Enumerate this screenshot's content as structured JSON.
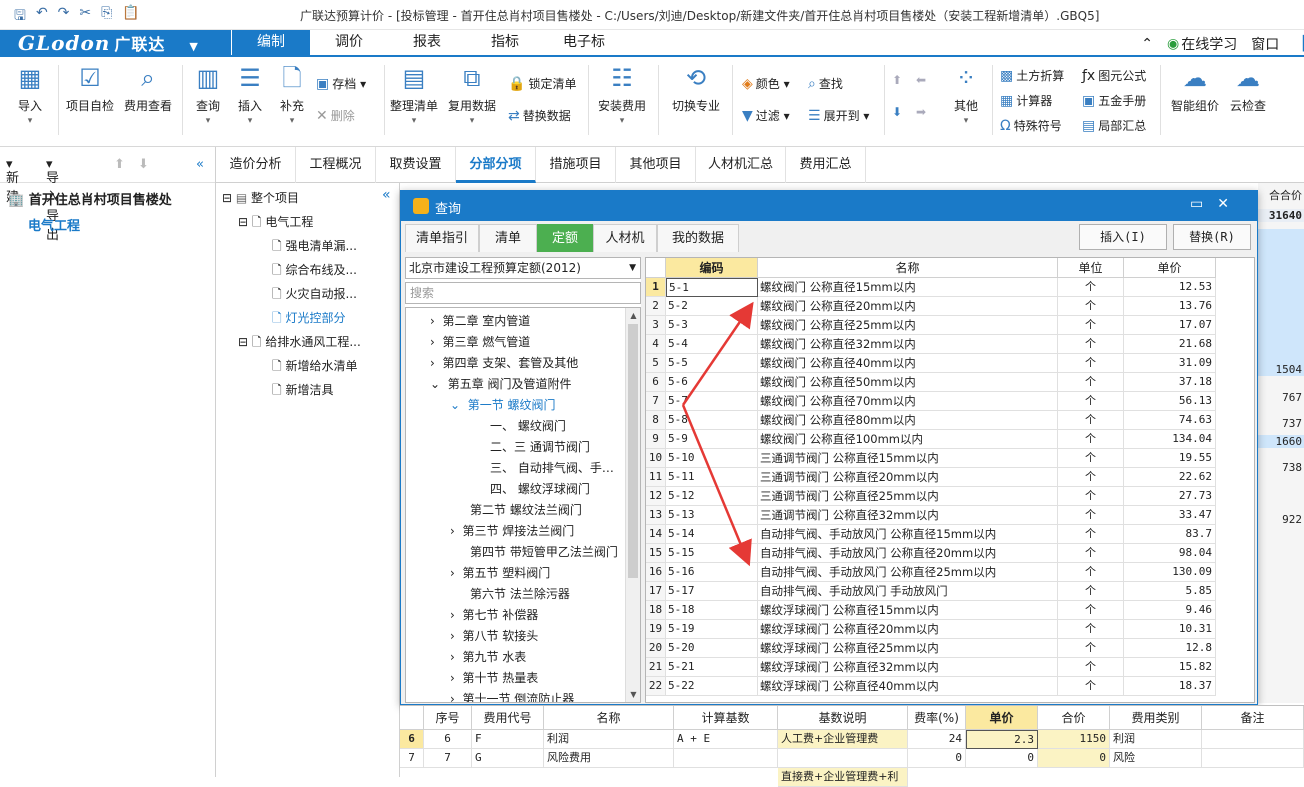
{
  "titlebar": {
    "title": "广联达预算计价 - [投标管理 - 首开住总肖村项目售楼处 - C:/Users/刘迪/Desktop/新建文件夹/首开住总肖村项目售楼处（安装工程新增清单）.GBQ5]"
  },
  "logo": {
    "text": "GLodon",
    "cn": "广联达"
  },
  "menu": {
    "tabs": [
      "编制",
      "调价",
      "报表",
      "指标",
      "电子标"
    ],
    "online": "在线学习",
    "window": "窗口"
  },
  "ribbon": {
    "import": "导入",
    "selfcheck": "项目自检",
    "feecheck": "费用查看",
    "query": "查询",
    "insert": "插入",
    "supplement": "补充",
    "storeprice": "存档",
    "delete": "删除",
    "organize": "整理清单",
    "reuse": "复用数据",
    "lock": "锁定清单",
    "replace": "替换数据",
    "install": "安装费用",
    "switch": "切换专业",
    "color": "颜色",
    "find": "查找",
    "filter": "过滤",
    "expand": "展开到",
    "other": "其他",
    "earth": "土方折算",
    "calc": "计算器",
    "special": "特殊符号",
    "formula": "图元公式",
    "hardware": "五金手册",
    "partial": "局部汇总",
    "smart": "智能组价",
    "cloud": "云检查"
  },
  "leftpanel": {
    "new": "新建",
    "importexport": "导入导出",
    "project": "首开住总肖村项目售楼处",
    "electrical": "电气工程"
  },
  "maintabs": [
    "造价分析",
    "工程概况",
    "取费设置",
    "分部分项",
    "措施项目",
    "其他项目",
    "人材机汇总",
    "费用汇总"
  ],
  "tree2": {
    "root": "整个项目",
    "n1": "电气工程",
    "n1a": "强电清单漏...",
    "n1b": "综合布线及...",
    "n1c": "火灾自动报...",
    "n1d": "灯光控部分",
    "n2": "给排水通风工程...",
    "n2a": "新增给水清单",
    "n2b": "新增洁具"
  },
  "dialog": {
    "title": "查询",
    "tabs": [
      "清单指引",
      "清单",
      "定额",
      "人材机",
      "我的数据"
    ],
    "insert_btn": "插入(I)",
    "replace_btn": "替换(R)",
    "quota": "北京市建设工程预算定额(2012)",
    "search_placeholder": "搜索",
    "tree": [
      "第二章 室内管道",
      "第三章 燃气管道",
      "第四章 支架、套管及其他",
      "第五章 阀门及管道附件",
      "第一节 螺纹阀门",
      "一、 螺纹阀门",
      "二、三 通调节阀门",
      "三、 自动排气阀、手…",
      "四、 螺纹浮球阀门",
      "第二节 螺纹法兰阀门",
      "第三节 焊接法兰阀门",
      "第四节 带短管甲乙法兰阀门",
      "第五节 塑料阀门",
      "第六节 法兰除污器",
      "第七节 补偿器",
      "第八节 软接头",
      "第九节 水表",
      "第十节 热量表",
      "第十一节 倒流防止器"
    ],
    "columns": [
      "编码",
      "名称",
      "单位",
      "单价"
    ],
    "rows": [
      [
        "1",
        "5-1",
        "螺纹阀门 公称直径15mm以内",
        "个",
        "12.53"
      ],
      [
        "2",
        "5-2",
        "螺纹阀门 公称直径20mm以内",
        "个",
        "13.76"
      ],
      [
        "3",
        "5-3",
        "螺纹阀门 公称直径25mm以内",
        "个",
        "17.07"
      ],
      [
        "4",
        "5-4",
        "螺纹阀门 公称直径32mm以内",
        "个",
        "21.68"
      ],
      [
        "5",
        "5-5",
        "螺纹阀门 公称直径40mm以内",
        "个",
        "31.09"
      ],
      [
        "6",
        "5-6",
        "螺纹阀门 公称直径50mm以内",
        "个",
        "37.18"
      ],
      [
        "7",
        "5-7",
        "螺纹阀门 公称直径70mm以内",
        "个",
        "56.13"
      ],
      [
        "8",
        "5-8",
        "螺纹阀门 公称直径80mm以内",
        "个",
        "74.63"
      ],
      [
        "9",
        "5-9",
        "螺纹阀门 公称直径100mm以内",
        "个",
        "134.04"
      ],
      [
        "10",
        "5-10",
        "三通调节阀门 公称直径15mm以内",
        "个",
        "19.55"
      ],
      [
        "11",
        "5-11",
        "三通调节阀门 公称直径20mm以内",
        "个",
        "22.62"
      ],
      [
        "12",
        "5-12",
        "三通调节阀门 公称直径25mm以内",
        "个",
        "27.73"
      ],
      [
        "13",
        "5-13",
        "三通调节阀门 公称直径32mm以内",
        "个",
        "33.47"
      ],
      [
        "14",
        "5-14",
        "自动排气阀、手动放风门 公称直径15mm以内",
        "个",
        "83.7"
      ],
      [
        "15",
        "5-15",
        "自动排气阀、手动放风门 公称直径20mm以内",
        "个",
        "98.04"
      ],
      [
        "16",
        "5-16",
        "自动排气阀、手动放风门 公称直径25mm以内",
        "个",
        "130.09"
      ],
      [
        "17",
        "5-17",
        "自动排气阀、手动放风门 手动放风门",
        "个",
        "5.85"
      ],
      [
        "18",
        "5-18",
        "螺纹浮球阀门 公称直径15mm以内",
        "个",
        "9.46"
      ],
      [
        "19",
        "5-19",
        "螺纹浮球阀门 公称直径20mm以内",
        "个",
        "10.31"
      ],
      [
        "20",
        "5-20",
        "螺纹浮球阀门 公称直径25mm以内",
        "个",
        "12.8"
      ],
      [
        "21",
        "5-21",
        "螺纹浮球阀门 公称直径32mm以内",
        "个",
        "15.82"
      ],
      [
        "22",
        "5-22",
        "螺纹浮球阀门 公称直径40mm以内",
        "个",
        "18.37"
      ]
    ]
  },
  "bottom": {
    "columns": [
      "序号",
      "费用代号",
      "名称",
      "计算基数",
      "基数说明",
      "费率(%)",
      "单价",
      "合价",
      "费用类别",
      "备注"
    ],
    "rows": [
      [
        "6",
        "6",
        "F",
        "利润",
        "A + E",
        "人工费+企业管理费",
        "24",
        "2.3",
        "1150",
        "利润",
        ""
      ],
      [
        "7",
        "7",
        "G",
        "风险费用",
        "",
        "",
        "0",
        "0",
        "0",
        "风险",
        ""
      ]
    ],
    "partial": "直接费+企业管理费+利"
  },
  "side": {
    "header": "合合价",
    "v1": "31640",
    "v2": "1504",
    "v3": "767",
    "v4": "737",
    "v5": "1660",
    "v6": "738",
    "v7": "922"
  },
  "colors": {
    "accent": "#1a7ac8",
    "active_tab": "#4caf50",
    "highlight": "#fbe9a0",
    "arrow": "#e53935"
  }
}
